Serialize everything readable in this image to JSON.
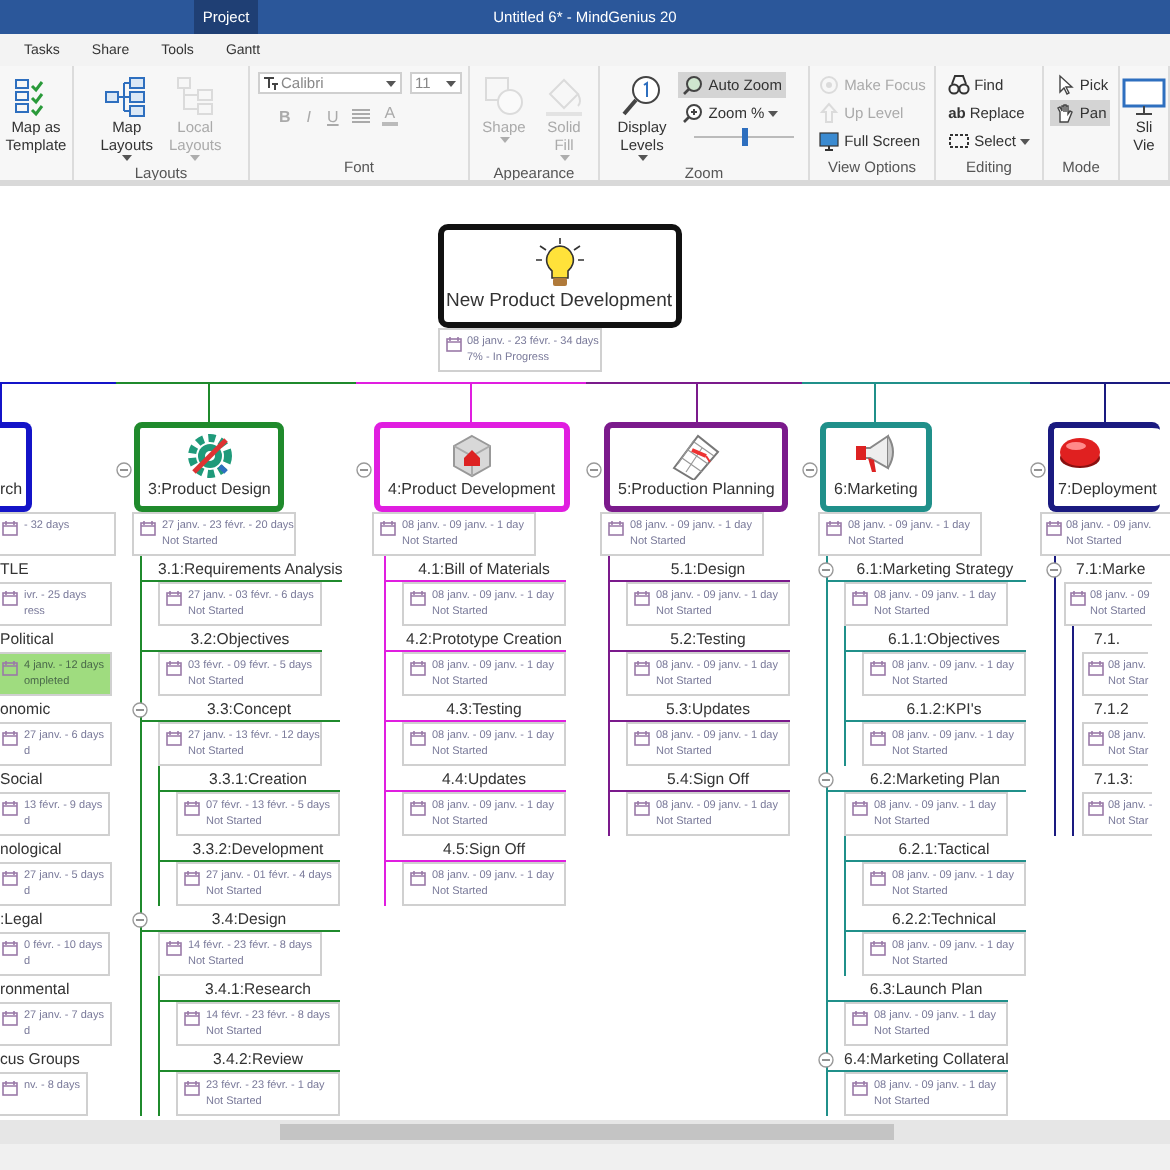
{
  "window": {
    "title": "Untitled 6* - MindGenius 20",
    "context_tab": "Project"
  },
  "menu_tabs": [
    {
      "label": "Tasks",
      "selected": false
    },
    {
      "label": "Share",
      "selected": false
    },
    {
      "label": "Tools",
      "selected": false
    },
    {
      "label": "Gantt",
      "selected": false
    }
  ],
  "ribbon": {
    "groups": [
      {
        "items": [
          {
            "kind": "large",
            "label": "Map as\nTemplate",
            "disabled": false,
            "dropdown": false
          }
        ]
      },
      {
        "label": "Layouts",
        "items": [
          {
            "kind": "large",
            "label": "Map\nLayouts",
            "disabled": false,
            "dropdown": true
          },
          {
            "kind": "large",
            "label": "Local\nLayouts",
            "disabled": true,
            "dropdown": true
          }
        ]
      },
      {
        "label": "Font",
        "items": [
          {
            "kind": "font",
            "font": "Calibri",
            "size": "11",
            "buttons": [
              {
                "kind": "glyph",
                "text": "B"
              },
              {
                "kind": "glyph",
                "text": "I"
              },
              {
                "kind": "glyph",
                "text": "U"
              },
              {
                "kind": "align"
              },
              {
                "kind": "color",
                "text": "A"
              }
            ]
          }
        ]
      },
      {
        "label": "Appearance",
        "items": [
          {
            "kind": "large",
            "label": "Shape",
            "disabled": true,
            "dropdown": true
          },
          {
            "kind": "large",
            "label": "Solid\nFill",
            "disabled": true,
            "dropdown": true
          }
        ]
      },
      {
        "label": "Zoom",
        "items": [
          {
            "kind": "large",
            "label": "Display\nLevels",
            "disabled": false,
            "dropdown": true
          },
          {
            "kind": "stack",
            "items": [
              {
                "kind": "small",
                "label": "Auto Zoom",
                "selected": true,
                "disabled": false,
                "dropdown": false
              },
              {
                "kind": "small",
                "label": "Zoom %",
                "selected": false,
                "disabled": false,
                "dropdown": true
              },
              {
                "kind": "slider",
                "level": 0.5
              }
            ]
          }
        ]
      },
      {
        "label": "View Options",
        "items": [
          {
            "kind": "stack",
            "items": [
              {
                "kind": "small",
                "label": "Make Focus",
                "selected": false,
                "disabled": true,
                "dropdown": false
              },
              {
                "kind": "small",
                "label": "Up Level",
                "selected": false,
                "disabled": true,
                "dropdown": false
              },
              {
                "kind": "small",
                "label": "Full Screen",
                "selected": false,
                "disabled": false,
                "dropdown": false
              }
            ]
          }
        ]
      },
      {
        "label": "Editing",
        "items": [
          {
            "kind": "stack",
            "items": [
              {
                "kind": "small",
                "label": "Find",
                "selected": false,
                "disabled": false,
                "dropdown": false
              },
              {
                "kind": "small",
                "label": "Replace",
                "glyph": "ab",
                "selected": false,
                "disabled": false,
                "dropdown": false
              },
              {
                "kind": "small",
                "label": "Select",
                "selected": false,
                "disabled": false,
                "dropdown": true
              }
            ]
          }
        ]
      },
      {
        "label": "Mode",
        "items": [
          {
            "kind": "stack",
            "items": [
              {
                "kind": "small",
                "label": "Pick",
                "selected": false,
                "disabled": false,
                "dropdown": false
              },
              {
                "kind": "small",
                "label": "Pan",
                "selected": true,
                "disabled": false,
                "dropdown": false
              }
            ]
          }
        ]
      },
      {
        "items": [
          {
            "kind": "large",
            "label": "Sli\nVie",
            "disabled": false,
            "dropdown": false
          }
        ]
      }
    ]
  },
  "map": {
    "root": {
      "title": "New Product Development",
      "dates": "08 janv. - 23 févr. - 34 days",
      "status": "7% - In Progress"
    },
    "branches": [
      {
        "title": "rch",
        "color": "#1414c8",
        "dates": "- 32 days",
        "children": [
          {
            "title": "TLE",
            "dates": "ivr. - 25 days",
            "status": "ress",
            "children": [
              {
                "title": "Political",
                "dates": "4 janv. - 12 days",
                "status": "ompleted",
                "completed": true
              },
              {
                "title": "onomic",
                "dates": "27 janv. - 6 days",
                "status": "d",
                "completed": false
              },
              {
                "title": "Social",
                "dates": "13 févr. - 9 days",
                "status": "d",
                "completed": false
              },
              {
                "title": "nological",
                "dates": "27 janv. - 5 days",
                "status": "d",
                "completed": false
              },
              {
                "title": ":Legal",
                "dates": "0 févr. - 10 days",
                "status": "d",
                "completed": false
              },
              {
                "title": "ronmental",
                "dates": "27 janv. - 7 days",
                "status": "d",
                "completed": false
              },
              {
                "title": "cus Groups",
                "dates": "nv. - 8 days",
                "completed": false
              }
            ]
          }
        ]
      },
      {
        "title": "3:Product Design",
        "color": "#1f8a2c",
        "expanded": true,
        "dates": "27 janv. - 23 févr. - 20 days",
        "status": "Not Started",
        "children": [
          {
            "title": "3.1:Requirements Analysis",
            "dates": "27 janv. - 03 févr. - 6 days",
            "status": "Not Started"
          },
          {
            "title": "3.2:Objectives",
            "dates": "03 févr. - 09 févr. - 5 days",
            "status": "Not Started"
          },
          {
            "title": "3.3:Concept",
            "expanded": true,
            "dates": "27 janv. - 13 févr. - 12 days",
            "status": "Not Started",
            "children": [
              {
                "title": "3.3.1:Creation",
                "dates": "07 févr. - 13 févr. - 5 days",
                "status": "Not Started"
              },
              {
                "title": "3.3.2:Development",
                "dates": "27 janv. - 01 févr. - 4 days",
                "status": "Not Started"
              }
            ]
          },
          {
            "title": "3.4:Design",
            "expanded": true,
            "dates": "14 févr. - 23 févr. - 8 days",
            "status": "Not Started",
            "children": [
              {
                "title": "3.4.1:Research",
                "dates": "14 févr. - 23 févr. - 8 days",
                "status": "Not Started"
              },
              {
                "title": "3.4.2:Review",
                "dates": "23 févr. - 23 févr. - 1 day",
                "status": "Not Started"
              }
            ]
          }
        ]
      },
      {
        "title": "4:Product Development",
        "color": "#e01ee0",
        "expanded": true,
        "dates": "08 janv. - 09 janv. - 1 day",
        "status": "Not Started",
        "children": [
          {
            "title": "4.1:Bill of Materials",
            "dates": "08 janv. - 09 janv. - 1 day",
            "status": "Not Started"
          },
          {
            "title": "4.2:Prototype Creation",
            "dates": "08 janv. - 09 janv. - 1 day",
            "status": "Not Started"
          },
          {
            "title": "4.3:Testing",
            "dates": "08 janv. - 09 janv. - 1 day",
            "status": "Not Started"
          },
          {
            "title": "4.4:Updates",
            "dates": "08 janv. - 09 janv. - 1 day",
            "status": "Not Started"
          },
          {
            "title": "4.5:Sign Off",
            "dates": "08 janv. - 09 janv. - 1 day",
            "status": "Not Started"
          }
        ]
      },
      {
        "title": "5:Production Planning",
        "color": "#7b1a8c",
        "expanded": true,
        "dates": "08 janv. - 09 janv. - 1 day",
        "status": "Not Started",
        "children": [
          {
            "title": "5.1:Design",
            "dates": "08 janv. - 09 janv. - 1 day",
            "status": "Not Started"
          },
          {
            "title": "5.2:Testing",
            "dates": "08 janv. - 09 janv. - 1 day",
            "status": "Not Started"
          },
          {
            "title": "5.3:Updates",
            "dates": "08 janv. - 09 janv. - 1 day",
            "status": "Not Started"
          },
          {
            "title": "5.4:Sign Off",
            "dates": "08 janv. - 09 janv. - 1 day",
            "status": "Not Started"
          }
        ]
      },
      {
        "title": "6:Marketing",
        "color": "#20908a",
        "expanded": true,
        "dates": "08 janv. - 09 janv. - 1 day",
        "status": "Not Started",
        "children": [
          {
            "title": "6.1:Marketing Strategy",
            "expanded": true,
            "dates": "08 janv. - 09 janv. - 1 day",
            "status": "Not Started",
            "children": [
              {
                "title": "6.1.1:Objectives",
                "dates": "08 janv. - 09 janv. - 1 day",
                "status": "Not Started"
              },
              {
                "title": "6.1.2:KPI's",
                "dates": "08 janv. - 09 janv. - 1 day",
                "status": "Not Started"
              }
            ]
          },
          {
            "title": "6.2:Marketing Plan",
            "expanded": true,
            "dates": "08 janv. - 09 janv. - 1 day",
            "status": "Not Started",
            "children": [
              {
                "title": "6.2.1:Tactical",
                "dates": "08 janv. - 09 janv. - 1 day",
                "status": "Not Started"
              },
              {
                "title": "6.2.2:Technical",
                "dates": "08 janv. - 09 janv. - 1 day",
                "status": "Not Started"
              }
            ]
          },
          {
            "title": "6.3:Launch Plan",
            "dates": "08 janv. - 09 janv. - 1 day",
            "status": "Not Started"
          },
          {
            "title": "6.4:Marketing Collateral",
            "expanded": true,
            "dates": "08 janv. - 09 janv. - 1 day",
            "status": "Not Started"
          }
        ]
      },
      {
        "title": "7:Deployment",
        "color": "#1a1a80",
        "expanded": true,
        "dates": "08 janv. - 09 janv.",
        "status": "Not Started",
        "children": [
          {
            "title": "7.1:Marke",
            "expanded": true,
            "dates": "08 janv. - 09",
            "status": "Not Started",
            "children": [
              {
                "title": "7.1.",
                "dates": "08 janv.",
                "status": "Not Star"
              },
              {
                "title": "7.1.2",
                "dates": "08 janv.",
                "status": "Not Star"
              },
              {
                "title": "7.1.3:",
                "dates": "08 janv. -",
                "status": "Not Star"
              }
            ]
          }
        ]
      }
    ]
  }
}
